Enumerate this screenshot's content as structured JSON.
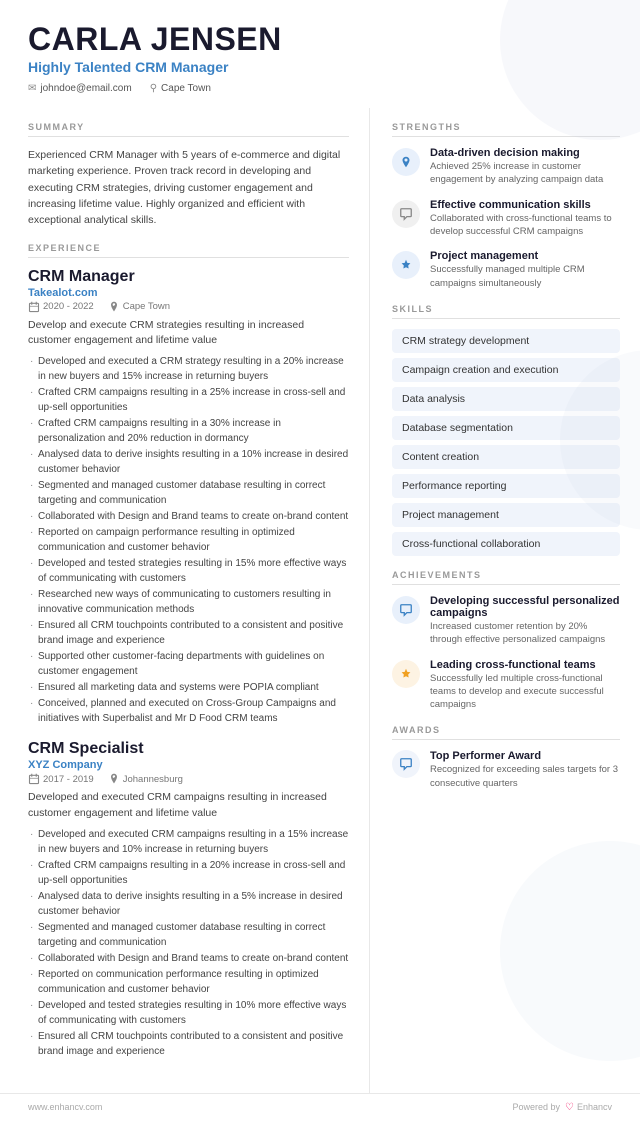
{
  "header": {
    "name": "CARLA JENSEN",
    "title": "Highly Talented CRM Manager",
    "email": "johndoe@email.com",
    "location": "Cape Town"
  },
  "summary": {
    "label": "SUMMARY",
    "text": "Experienced CRM Manager with 5 years of e-commerce and digital marketing experience. Proven track record in developing and executing CRM strategies, driving customer engagement and increasing lifetime value. Highly organized and efficient with exceptional analytical skills."
  },
  "experience": {
    "label": "EXPERIENCE",
    "items": [
      {
        "title": "CRM Manager",
        "company": "Takealot.com",
        "period": "2020 - 2022",
        "location": "Cape Town",
        "intro": "Develop and execute CRM strategies resulting in increased customer engagement and lifetime value",
        "bullets": [
          "Developed and executed a CRM strategy resulting in a 20% increase in new buyers and 15% increase in returning buyers",
          "Crafted CRM campaigns resulting in a 25% increase in cross-sell and up-sell opportunities",
          "Crafted CRM campaigns resulting in a 30% increase in personalization and 20% reduction in dormancy",
          "Analysed data to derive insights resulting in a 10% increase in desired customer behavior",
          "Segmented and managed customer database resulting in correct targeting and communication",
          "Collaborated with Design and Brand teams to create on-brand content",
          "Reported on campaign performance resulting in optimized communication and customer behavior",
          "Developed and tested strategies resulting in 15% more effective ways of communicating with customers",
          "Researched new ways of communicating to customers resulting in innovative communication methods",
          "Ensured all CRM touchpoints contributed to a consistent and positive brand image and experience",
          "Supported other customer-facing departments with guidelines on customer engagement",
          "Ensured all marketing data and systems were POPIA compliant",
          "Conceived, planned and executed on Cross-Group Campaigns and initiatives with Superbalist and Mr D Food CRM teams"
        ]
      },
      {
        "title": "CRM Specialist",
        "company": "XYZ Company",
        "period": "2017 - 2019",
        "location": "Johannesburg",
        "intro": "Developed and executed CRM campaigns resulting in increased customer engagement and lifetime value",
        "bullets": [
          "Developed and executed CRM campaigns resulting in a 15% increase in new buyers and 10% increase in returning buyers",
          "Crafted CRM campaigns resulting in a 20% increase in cross-sell and up-sell opportunities",
          "Analysed data to derive insights resulting in a 5% increase in desired customer behavior",
          "Segmented and managed customer database resulting in correct targeting and communication",
          "Collaborated with Design and Brand teams to create on-brand content",
          "Reported on communication performance resulting in optimized communication and customer behavior",
          "Developed and tested strategies resulting in 10% more effective ways of communicating with customers",
          "Ensured all CRM touchpoints contributed to a consistent and positive brand image and experience"
        ]
      }
    ]
  },
  "strengths": {
    "label": "STRENGTHS",
    "items": [
      {
        "title": "Data-driven decision making",
        "desc": "Achieved 25% increase in customer engagement by analyzing campaign data",
        "icon": "pin"
      },
      {
        "title": "Effective communication skills",
        "desc": "Collaborated with cross-functional teams to develop successful CRM campaigns",
        "icon": "pencil"
      },
      {
        "title": "Project management",
        "desc": "Successfully managed multiple CRM campaigns simultaneously",
        "icon": "trophy"
      }
    ]
  },
  "skills": {
    "label": "SKILLS",
    "items": [
      "CRM strategy development",
      "Campaign creation and execution",
      "Data analysis",
      "Database segmentation",
      "Content creation",
      "Performance reporting",
      "Project management",
      "Cross-functional collaboration"
    ]
  },
  "achievements": {
    "label": "ACHIEVEMENTS",
    "items": [
      {
        "title": "Developing successful personalized campaigns",
        "desc": "Increased customer retention by 20% through effective personalized campaigns",
        "icon": "pencil"
      },
      {
        "title": "Leading cross-functional teams",
        "desc": "Successfully led multiple cross-functional teams to develop and execute successful campaigns",
        "icon": "star"
      }
    ]
  },
  "awards": {
    "label": "AWARDS",
    "items": [
      {
        "title": "Top Performer Award",
        "desc": "Recognized for exceeding sales targets for 3 consecutive quarters",
        "icon": "pencil"
      }
    ]
  },
  "footer": {
    "url": "www.enhancv.com",
    "powered_by": "Powered by",
    "brand": "Enhancv"
  }
}
